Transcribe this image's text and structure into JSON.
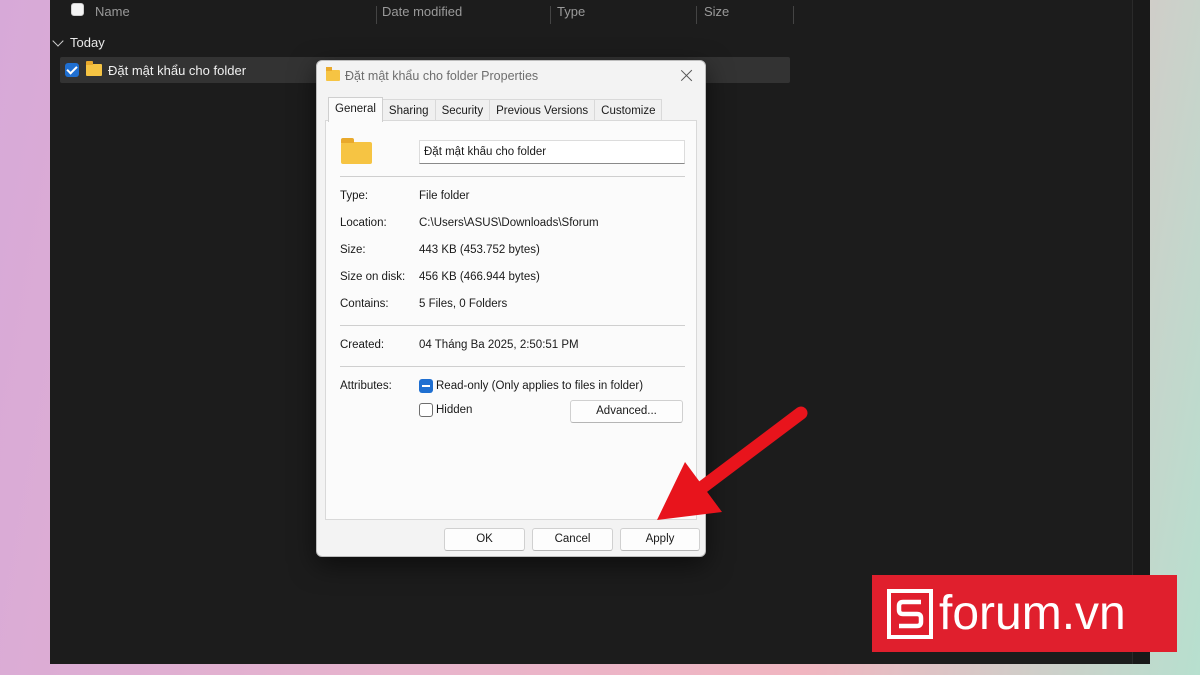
{
  "explorer": {
    "columns": [
      "Name",
      "Date modified",
      "Type",
      "Size"
    ],
    "group_label": "Today",
    "row_name": "Đặt mật khẩu cho folder"
  },
  "dialog": {
    "title": "Đặt mật khẩu cho folder Properties",
    "tabs": [
      "General",
      "Sharing",
      "Security",
      "Previous Versions",
      "Customize"
    ],
    "active_tab": "General",
    "folder_name_value": "Đặt mật khẩu cho folder",
    "fields": {
      "type_label": "Type:",
      "type_value": "File folder",
      "location_label": "Location:",
      "location_value": "C:\\Users\\ASUS\\Downloads\\Sforum",
      "size_label": "Size:",
      "size_value": "443 KB (453.752 bytes)",
      "size_on_disk_label": "Size on disk:",
      "size_on_disk_value": "456 KB (466.944 bytes)",
      "contains_label": "Contains:",
      "contains_value": "5 Files, 0 Folders",
      "created_label": "Created:",
      "created_value": "04 Tháng Ba 2025, 2:50:51 PM"
    },
    "attributes": {
      "label": "Attributes:",
      "readonly_label": "Read-only (Only applies to files in folder)",
      "readonly_state": "indeterminate",
      "hidden_label": "Hidden",
      "hidden_state": "unchecked",
      "advanced_label": "Advanced..."
    },
    "buttons": {
      "ok": "OK",
      "cancel": "Cancel",
      "apply": "Apply"
    }
  },
  "watermark": {
    "logo_text": "forum.vn",
    "brand_color": "#e01f2d"
  },
  "arrow_color": "#e8141c"
}
